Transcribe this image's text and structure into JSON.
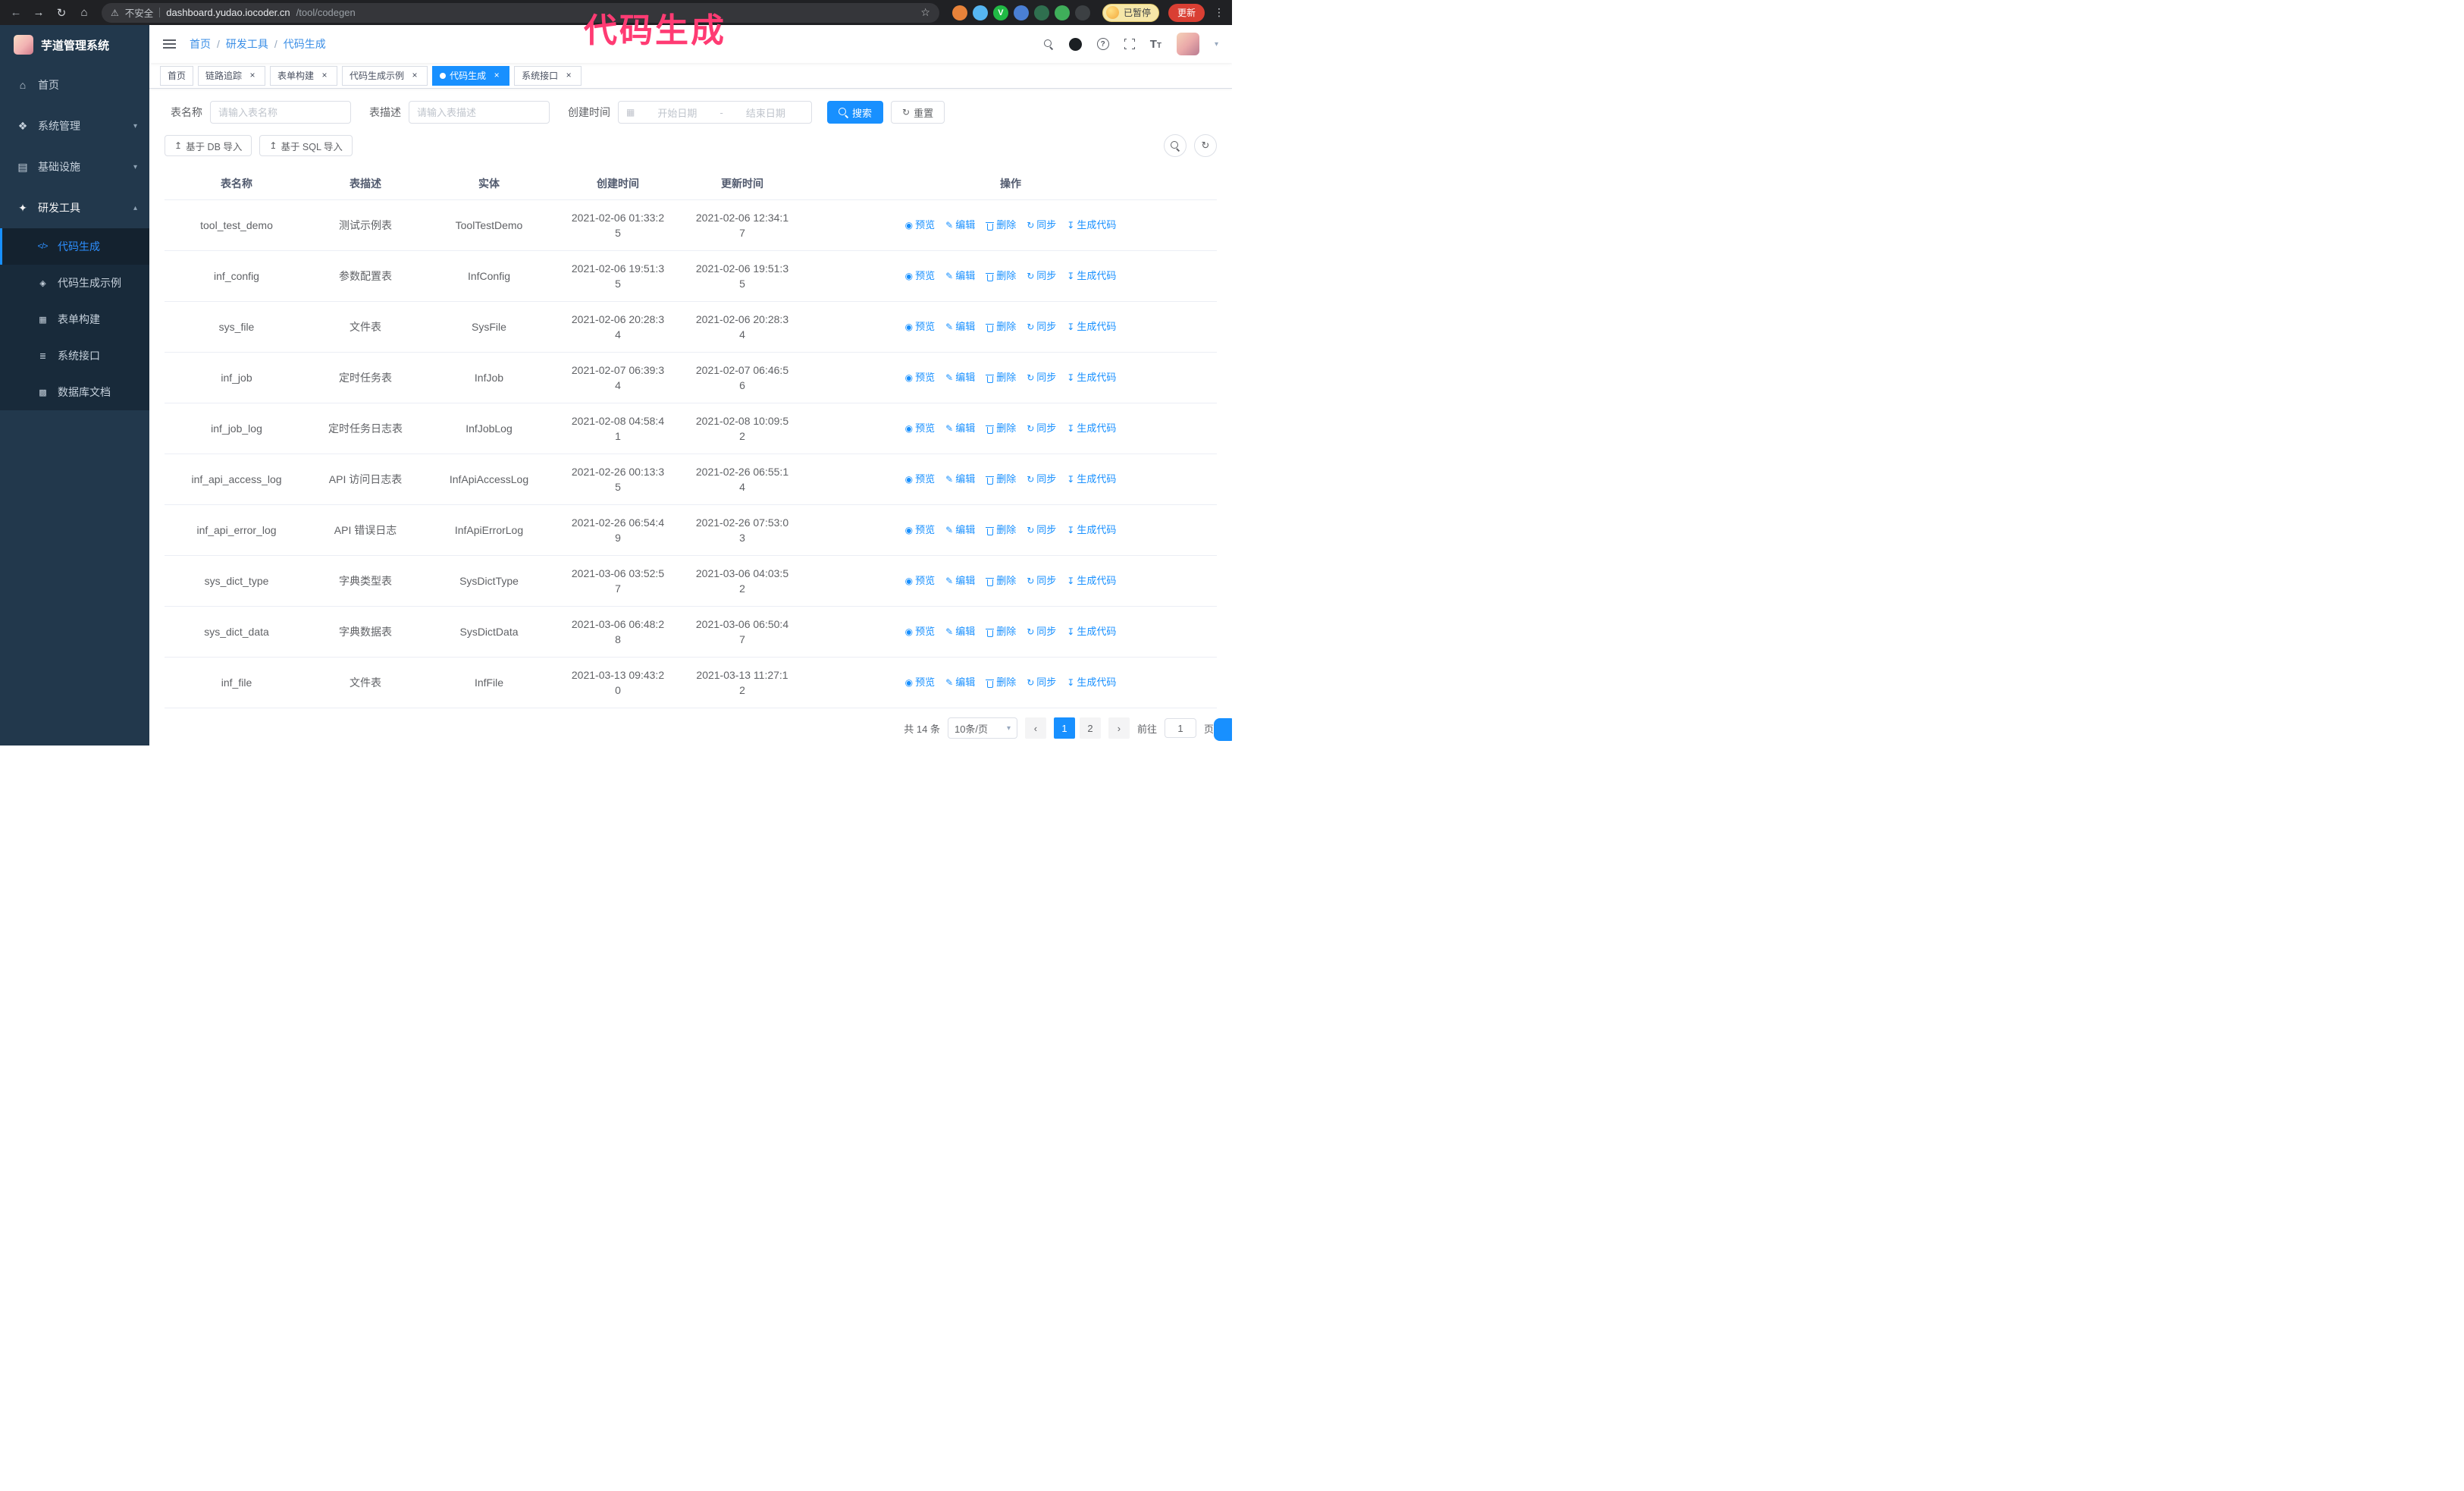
{
  "colors": {
    "primary": "#1890ff",
    "annotation": "#ff3b73",
    "sidebar_bg": "#22384c",
    "submenu_bg": "#182a3a",
    "tab_active": "#1890ff"
  },
  "annotation": {
    "text": "代码生成"
  },
  "browser": {
    "security_label": "不安全",
    "url_host": "dashboard.yudao.iocoder.cn",
    "url_path": "/tool/codegen",
    "paused_badge": "已暂停",
    "update_button": "更新",
    "extensions": [
      {
        "name": "fox-extension-icon",
        "color": "#e8833a"
      },
      {
        "name": "drop-extension-icon",
        "color": "#56b6f2"
      },
      {
        "name": "v-extension-icon",
        "color": "#21ba45",
        "letter": "V"
      },
      {
        "name": "team-extension-icon",
        "color": "#4a7fd4"
      },
      {
        "name": "screen-extension-icon",
        "color": "#2f6f4f"
      },
      {
        "name": "leaf-extension-icon",
        "color": "#3fae5a"
      },
      {
        "name": "puzzle-extension-icon",
        "color": "#3c4043"
      }
    ]
  },
  "sidebar": {
    "logo_title": "芋道管理系统",
    "items": [
      {
        "id": "home",
        "label": "首页",
        "icon": "home-icon"
      },
      {
        "id": "system",
        "label": "系统管理",
        "icon": "system-icon",
        "chevron": "down"
      },
      {
        "id": "infra",
        "label": "基础设施",
        "icon": "infra-icon",
        "chevron": "down"
      },
      {
        "id": "devtools",
        "label": "研发工具",
        "icon": "tools-icon",
        "chevron": "up",
        "active_parent": true
      }
    ],
    "sub_items": [
      {
        "id": "codegen",
        "label": "代码生成",
        "icon": "code-icon",
        "active": true
      },
      {
        "id": "codegen-example",
        "label": "代码生成示例",
        "icon": "example-icon"
      },
      {
        "id": "form-builder",
        "label": "表单构建",
        "icon": "form-icon"
      },
      {
        "id": "system-api",
        "label": "系统接口",
        "icon": "api-icon"
      },
      {
        "id": "db-doc",
        "label": "数据库文档",
        "icon": "dbdoc-icon"
      }
    ]
  },
  "header": {
    "breadcrumb": [
      "首页",
      "研发工具",
      "代码生成"
    ]
  },
  "tabs": [
    {
      "id": "home",
      "label": "首页",
      "closable": false,
      "active": false
    },
    {
      "id": "tracer",
      "label": "链路追踪",
      "closable": true,
      "active": false
    },
    {
      "id": "form-builder",
      "label": "表单构建",
      "closable": true,
      "active": false
    },
    {
      "id": "codegen-example",
      "label": "代码生成示例",
      "closable": true,
      "active": false
    },
    {
      "id": "codegen",
      "label": "代码生成",
      "closable": true,
      "active": true
    },
    {
      "id": "system-api",
      "label": "系统接口",
      "closable": true,
      "active": false
    }
  ],
  "filters": {
    "table_name_label": "表名称",
    "table_name_placeholder": "请输入表名称",
    "table_desc_label": "表描述",
    "table_desc_placeholder": "请输入表描述",
    "create_time_label": "创建时间",
    "date_start_placeholder": "开始日期",
    "date_separator": "-",
    "date_end_placeholder": "结束日期",
    "search_button": "搜索",
    "reset_button": "重置"
  },
  "toolbar": {
    "import_db_button": "基于 DB 导入",
    "import_sql_button": "基于 SQL 导入"
  },
  "table": {
    "columns": [
      "表名称",
      "表描述",
      "实体",
      "创建时间",
      "更新时间",
      "操作"
    ],
    "actions": [
      "预览",
      "编辑",
      "删除",
      "同步",
      "生成代码"
    ],
    "rows": [
      [
        "tool_test_demo",
        "测试示例表",
        "ToolTestDemo",
        "2021-02-06 01:33:25",
        "2021-02-06 12:34:17"
      ],
      [
        "inf_config",
        "参数配置表",
        "InfConfig",
        "2021-02-06 19:51:35",
        "2021-02-06 19:51:35"
      ],
      [
        "sys_file",
        "文件表",
        "SysFile",
        "2021-02-06 20:28:34",
        "2021-02-06 20:28:34"
      ],
      [
        "inf_job",
        "定时任务表",
        "InfJob",
        "2021-02-07 06:39:34",
        "2021-02-07 06:46:56"
      ],
      [
        "inf_job_log",
        "定时任务日志表",
        "InfJobLog",
        "2021-02-08 04:58:41",
        "2021-02-08 10:09:52"
      ],
      [
        "inf_api_access_log",
        "API 访问日志表",
        "InfApiAccessLog",
        "2021-02-26 00:13:35",
        "2021-02-26 06:55:14"
      ],
      [
        "inf_api_error_log",
        "API 错误日志",
        "InfApiErrorLog",
        "2021-02-26 06:54:49",
        "2021-02-26 07:53:03"
      ],
      [
        "sys_dict_type",
        "字典类型表",
        "SysDictType",
        "2021-03-06 03:52:57",
        "2021-03-06 04:03:52"
      ],
      [
        "sys_dict_data",
        "字典数据表",
        "SysDictData",
        "2021-03-06 06:48:28",
        "2021-03-06 06:50:47"
      ],
      [
        "inf_file",
        "文件表",
        "InfFile",
        "2021-03-13 09:43:20",
        "2021-03-13 11:27:12"
      ]
    ]
  },
  "pagination": {
    "total_text": "共 14 条",
    "page_size": "10条/页",
    "pages": [
      "1",
      "2"
    ],
    "active_page": "1",
    "goto_label": "前往",
    "goto_value": "1",
    "goto_suffix": "页"
  }
}
